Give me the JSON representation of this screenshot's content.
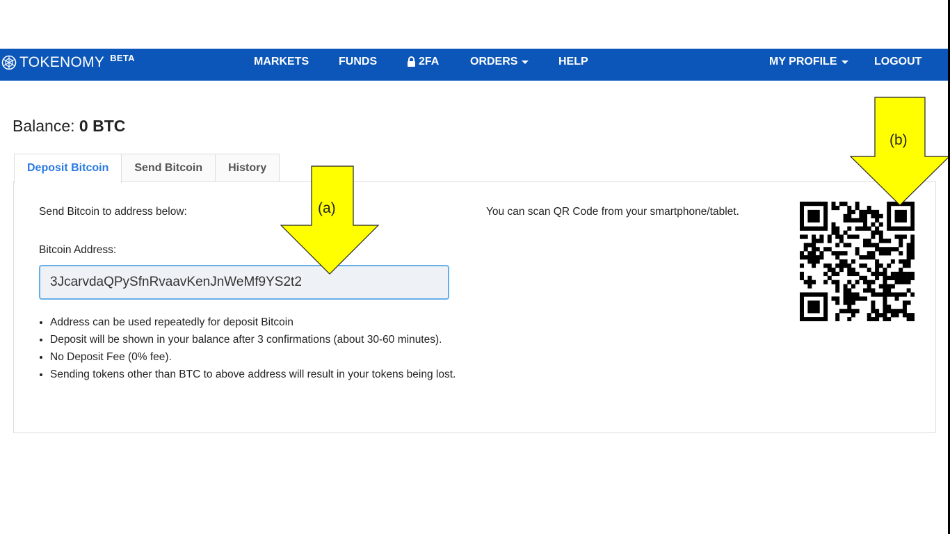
{
  "brand": {
    "name": "TOKENOMY",
    "badge": "BETA"
  },
  "nav": {
    "markets": "MARKETS",
    "funds": "FUNDS",
    "twofa": "2FA",
    "orders": "ORDERS",
    "help": "HELP",
    "profile": "MY PROFILE",
    "logout": "LOGOUT"
  },
  "balance": {
    "label": "Balance:",
    "value": "0 BTC"
  },
  "tabs": [
    "Deposit Bitcoin",
    "Send Bitcoin",
    "History"
  ],
  "deposit": {
    "instruction": "Send Bitcoin to address below:",
    "address_label": "Bitcoin Address:",
    "address": "3JcarvdaQPySfnRvaavKenJnWeMf9YS2t2",
    "notes": [
      "Address can be used repeatedly for deposit Bitcoin",
      "Deposit will be shown in your balance after 3 confirmations (about 30-60 minutes).",
      "No Deposit Fee (0% fee).",
      "Sending tokens other than BTC to above address will result in your tokens being lost."
    ],
    "qr_hint": "You can scan QR Code from your smartphone/tablet."
  },
  "annotations": {
    "a": "(a)",
    "b": "(b)"
  },
  "colors": {
    "navbar": "#0b56b8",
    "active_tab": "#2a7ae2",
    "callout": "#ffff00"
  }
}
